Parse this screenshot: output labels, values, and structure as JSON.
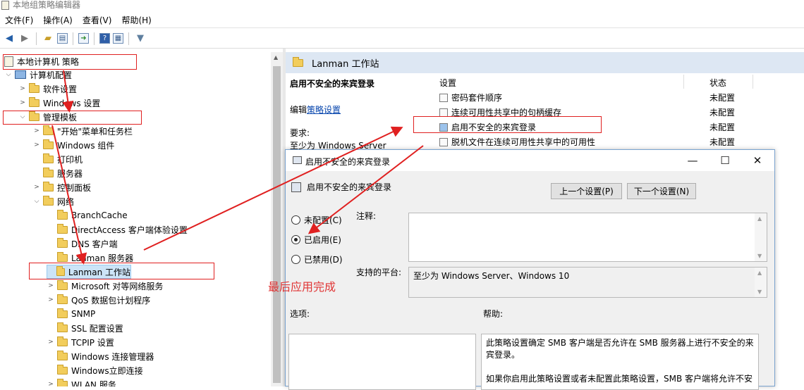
{
  "window": {
    "title": "本地组策略编辑器"
  },
  "menu": [
    "文件(F)",
    "操作(A)",
    "查看(V)",
    "帮助(H)"
  ],
  "toolbar": {
    "icons": [
      "back-arrow-icon",
      "forward-arrow-icon",
      "folder-up-icon",
      "show-hide-tree-icon",
      "export-list-icon",
      "help-icon",
      "properties-icon",
      "filter-icon"
    ]
  },
  "tree": {
    "root": "本地计算机 策略",
    "computer_config": "计算机配置",
    "software": "软件设置",
    "windows_settings": "Windows 设置",
    "admin_templates": "管理模板",
    "start_menu": "\"开始\"菜单和任务栏",
    "windows_components": "Windows 组件",
    "printers": "打印机",
    "server": "服务器",
    "control_panel": "控制面板",
    "network": "网络",
    "branchcache": "BranchCache",
    "directaccess": "DirectAccess 客户端体验设置",
    "dns": "DNS 客户端",
    "lanman_server": "Lanman 服务器",
    "lanman_workstation": "Lanman 工作站",
    "ms_network": "Microsoft 对等网络服务",
    "qos": "QoS 数据包计划程序",
    "snmp": "SNMP",
    "ssl": "SSL 配置设置",
    "tcpip": "TCPIP 设置",
    "wcm": "Windows 连接管理器",
    "wconnect": "Windows立即连接",
    "wlan": "WLAN 服务"
  },
  "right": {
    "header": "Lanman 工作站",
    "desc_title": "启用不安全的来宾登录",
    "edit_prefix": "编辑",
    "edit_link": "策略设置",
    "req_label": "要求:",
    "req_value": "至少为 Windows Server",
    "col_setting": "设置",
    "col_state": "状态",
    "rows": [
      {
        "name": "密码套件顺序",
        "state": "未配置"
      },
      {
        "name": "连续可用性共享中的句柄缓存",
        "state": "未配置"
      },
      {
        "name": "启用不安全的来宾登录",
        "state": "未配置"
      },
      {
        "name": "脱机文件在连续可用性共享中的可用性",
        "state": "未配置"
      }
    ]
  },
  "dialog": {
    "title": "启用不安全的来宾登录",
    "subtitle": "启用不安全的来宾登录",
    "prev": "上一个设置(P)",
    "next": "下一个设置(N)",
    "minimize": "—",
    "maximize": "☐",
    "close": "✕",
    "radio_not_configured": "未配置(C)",
    "radio_enabled": "已启用(E)",
    "radio_disabled": "已禁用(D)",
    "selected": "enabled",
    "comment_label": "注释:",
    "comment_value": "",
    "platform_label": "支持的平台:",
    "platform_value": "至少为 Windows Server、Windows 10",
    "options_label": "选项:",
    "help_label": "帮助:",
    "help_text_1": "此策略设置确定 SMB 客户端是否允许在 SMB 服务器上进行不安全的来宾登录。",
    "help_text_2": "如果你启用此策略设置或者未配置此策略设置，SMB 客户端将允许不安"
  },
  "annotation": {
    "text": "最后应用完成",
    "color": "#e03535"
  }
}
